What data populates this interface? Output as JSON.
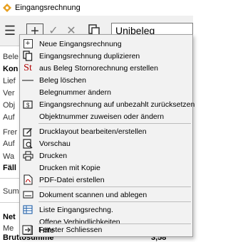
{
  "window": {
    "title": "Eingangsrechnung"
  },
  "toolbar": {
    "document_type": "Unibeleg"
  },
  "form": {
    "labels": [
      "Bele",
      "Kon",
      "Lief",
      "Ver",
      "Obj",
      "Auf",
      "Frer",
      "Auf",
      "Wa",
      "Fäll",
      "Sum",
      "Net",
      "Me",
      "Bruttosumme"
    ],
    "brutto_value": "3,58"
  },
  "menu": {
    "items": [
      {
        "label": "Neue Eingangsrechnung",
        "icon": "plus-icon"
      },
      {
        "label": "Eingangsrechnung duplizieren",
        "icon": "copy-icon"
      },
      {
        "label": "aus Beleg Stornorechnung erstellen",
        "icon": "storno-icon"
      },
      {
        "label": "Beleg löschen",
        "icon": "minus-icon"
      },
      {
        "label": "Belegnummer ändern",
        "icon": ""
      },
      {
        "label": "Eingangsrechnung auf unbezahlt zurücksetzen",
        "icon": "money-reset-icon"
      },
      {
        "label": "Objektnummer zuweisen oder ändern",
        "icon": ""
      },
      {
        "label": "Drucklayout bearbeiten/erstellen",
        "icon": "edit-layout-icon"
      },
      {
        "label": "Vorschau",
        "icon": "preview-icon"
      },
      {
        "label": "Drucken",
        "icon": "printer-icon"
      },
      {
        "label": "Drucken mit Kopie",
        "icon": ""
      },
      {
        "label": "PDF-Datei erstellen",
        "icon": "pdf-icon"
      },
      {
        "label": "Dokument scannen und ablegen",
        "icon": "scanner-icon"
      },
      {
        "label": "Liste Eingangsrechng.",
        "icon": "list-icon"
      },
      {
        "label": "Offene Verbindlichkeiten",
        "icon": ""
      },
      {
        "label": "Hilfe",
        "icon": "help-icon"
      },
      {
        "label": "Fenster Schliessen",
        "icon": "exit-icon"
      }
    ]
  }
}
